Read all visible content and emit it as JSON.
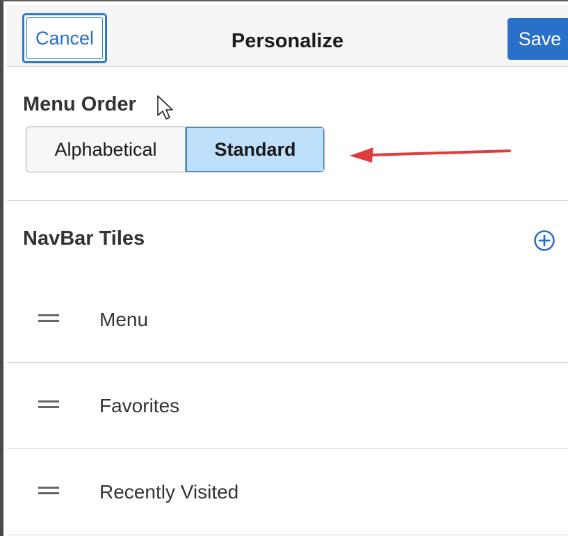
{
  "header": {
    "cancel_label": "Cancel",
    "title": "Personalize",
    "save_label": "Save"
  },
  "menu_order": {
    "title": "Menu Order",
    "options": [
      "Alphabetical",
      "Standard"
    ],
    "selected": "Standard"
  },
  "navbar_tiles": {
    "title": "NavBar Tiles",
    "add_icon": "plus-circle-icon",
    "items": [
      {
        "label": "Menu"
      },
      {
        "label": "Favorites"
      },
      {
        "label": "Recently Visited"
      }
    ]
  },
  "colors": {
    "accent": "#2a6fc9",
    "selected_segment": "#bfe0fb",
    "annotation_arrow": "#e03c3c"
  }
}
